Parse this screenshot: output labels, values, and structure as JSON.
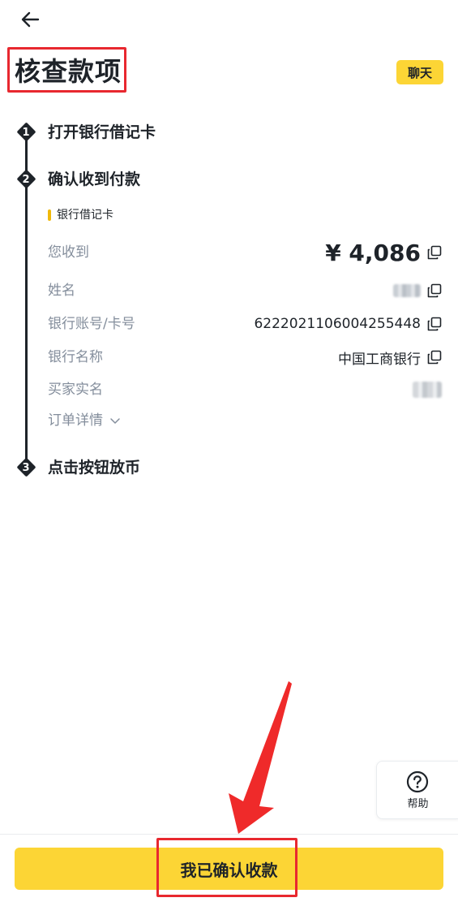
{
  "header": {
    "back_icon": "arrow-left-icon",
    "title": "核查款项",
    "chat_label": "聊天"
  },
  "steps": [
    {
      "number": "1",
      "label": "打开银行借记卡"
    },
    {
      "number": "2",
      "label": "确认收到付款"
    },
    {
      "number": "3",
      "label": "点击按钮放币"
    }
  ],
  "payment": {
    "method": "银行借记卡",
    "rows": {
      "received": {
        "label": "您收到",
        "value": "¥ 4,086"
      },
      "name": {
        "label": "姓名"
      },
      "account": {
        "label": "银行账号/卡号",
        "value": "6222021106004255448"
      },
      "bank": {
        "label": "银行名称",
        "value": "中国工商银行"
      },
      "buyer": {
        "label": "买家实名"
      }
    },
    "order_details_label": "订单详情"
  },
  "help": {
    "label": "帮助",
    "icon": "question-circle-icon"
  },
  "confirm_button_label": "我已确认收款",
  "colors": {
    "accent_yellow": "#fcd535",
    "annotation_red": "#e8282f",
    "text_primary": "#1e2329",
    "text_secondary": "#848e9c"
  }
}
